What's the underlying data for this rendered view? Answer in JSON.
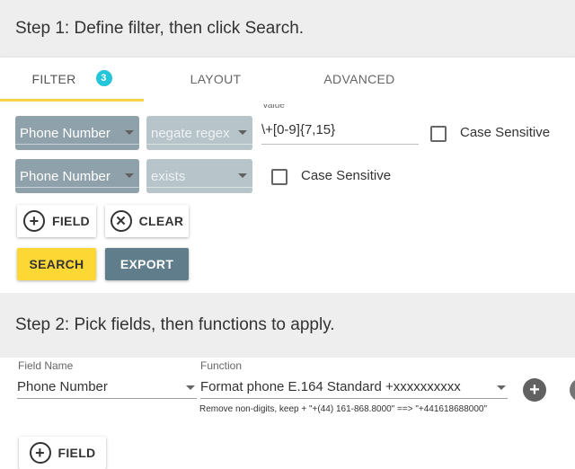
{
  "step1": {
    "title": "Step 1: Define filter, then click Search."
  },
  "tabs": [
    {
      "label": "FILTER",
      "badge": "3"
    },
    {
      "label": "LAYOUT"
    },
    {
      "label": "ADVANCED"
    }
  ],
  "filters": [
    {
      "field": "Phone Number",
      "operator": "negate regex",
      "value_label": "Value",
      "value": "\\+[0-9]{7,15}",
      "case_label": "Case Sensitive"
    },
    {
      "field": "Phone Number",
      "operator": "exists",
      "case_label": "Case Sensitive"
    }
  ],
  "buttons": {
    "add_field": "FIELD",
    "clear": "CLEAR",
    "search": "SEARCH",
    "export": "EXPORT"
  },
  "step2": {
    "title": "Step 2: Pick fields, then functions to apply.",
    "field_name_label": "Field Name",
    "field_name": "Phone Number",
    "function_label": "Function",
    "function": "Format phone E.164 Standard +xxxxxxxxxx",
    "function_hint": "Remove non-digits, keep + \"+(44) 161-868.8000\" ==> \"+441618688000\"",
    "add_field": "FIELD"
  },
  "colors": {
    "accent": "#fdd835",
    "badge": "#26c6da",
    "export": "#607d8b",
    "select_dark": "#8fa1ab",
    "select_light": "#b7c4ca"
  }
}
